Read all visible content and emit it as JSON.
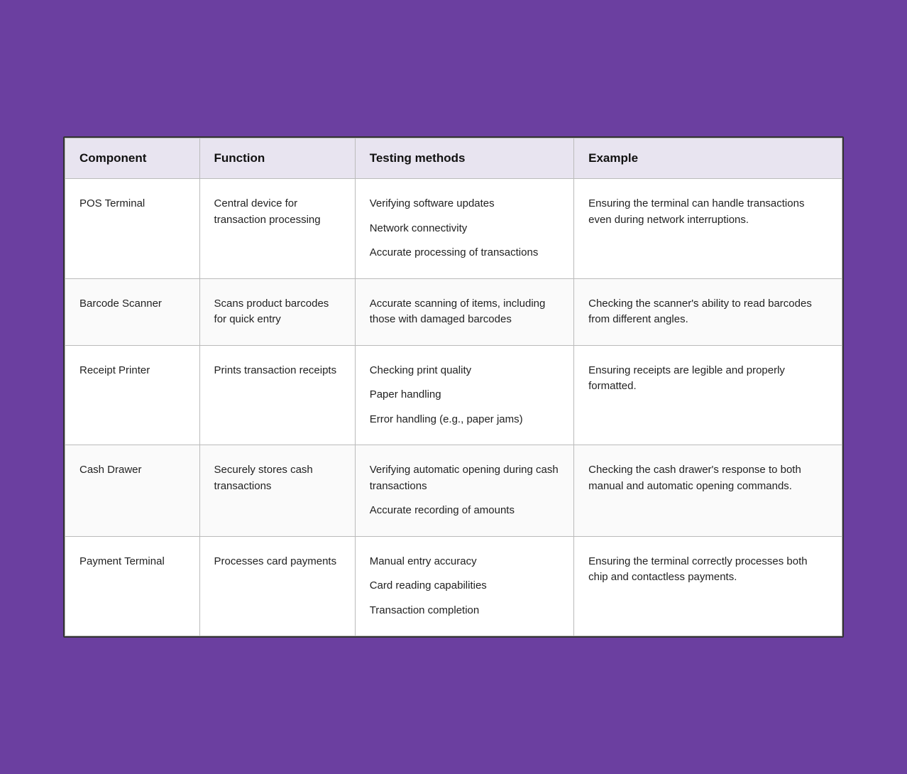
{
  "table": {
    "headers": {
      "component": "Component",
      "function": "Function",
      "testing": "Testing methods",
      "example": "Example"
    },
    "rows": [
      {
        "component": "POS Terminal",
        "function": "Central device for transaction processing",
        "testing_methods": [
          "Verifying software updates",
          "Network connectivity",
          "Accurate processing of transactions"
        ],
        "example": "Ensuring the terminal can handle transactions even during network interruptions."
      },
      {
        "component": "Barcode Scanner",
        "function": "Scans product barcodes for quick entry",
        "testing_methods": [
          "Accurate scanning of items, including those with damaged barcodes"
        ],
        "example": "Checking the scanner's ability to read barcodes from different angles."
      },
      {
        "component": "Receipt Printer",
        "function": "Prints transaction receipts",
        "testing_methods": [
          "Checking print quality",
          "Paper handling",
          "Error handling (e.g., paper jams)"
        ],
        "example": "Ensuring receipts are legible and properly formatted."
      },
      {
        "component": "Cash Drawer",
        "function": "Securely stores cash transactions",
        "testing_methods": [
          "Verifying automatic opening during cash transactions",
          "Accurate recording of amounts"
        ],
        "example": "Checking the cash drawer's response to both manual and automatic opening commands."
      },
      {
        "component": "Payment Terminal",
        "function": "Processes card payments",
        "testing_methods": [
          "Manual entry accuracy",
          "Card reading capabilities",
          "Transaction completion"
        ],
        "example": "Ensuring the terminal correctly processes both chip and contactless payments."
      }
    ]
  }
}
